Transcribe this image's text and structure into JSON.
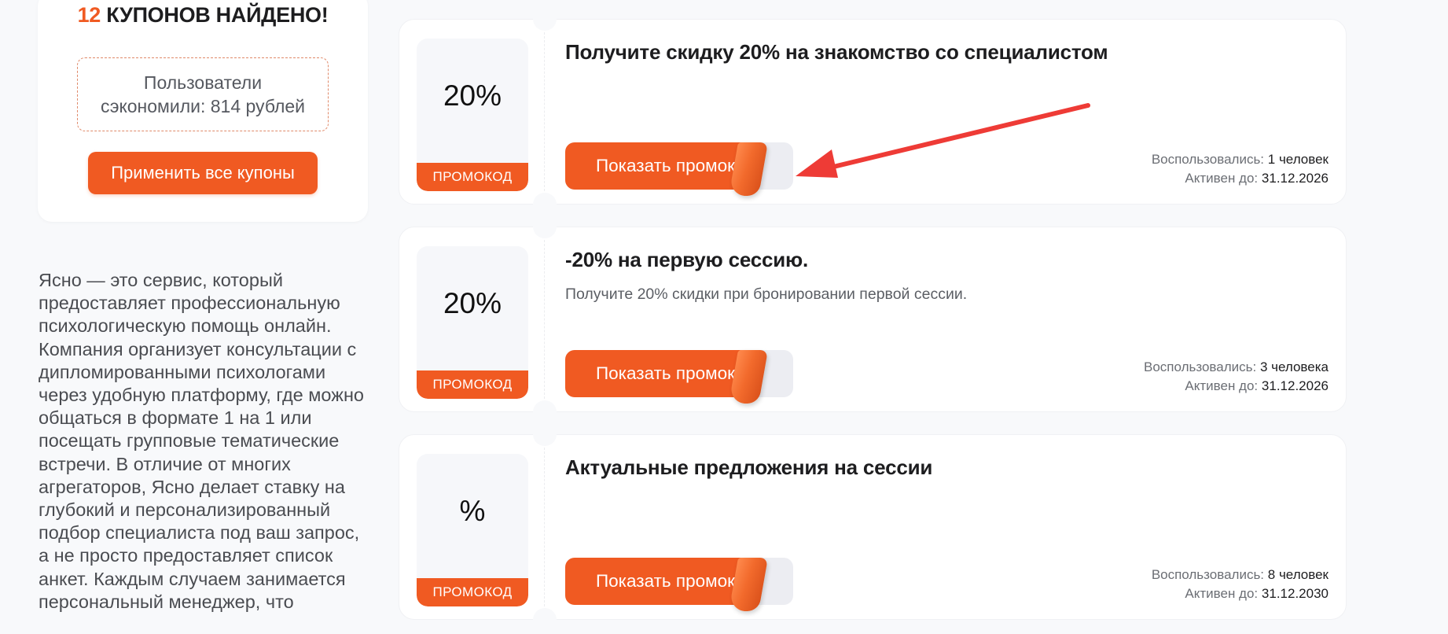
{
  "summary": {
    "count": "12",
    "found_label": "КУПОНОВ НАЙДЕНО!",
    "savings_line1": "Пользователи",
    "savings_line2": "сэкономили: 814 рублей",
    "apply_all_label": "Применить все купоны"
  },
  "about": {
    "text": "Ясно — это сервис, который предоставляет профессиональную психологическую помощь онлайн. Компания организует консультации с дипломированными психологами через удобную платформу, где можно общаться в формате 1 на 1 или посещать групповые тематические встречи. В отличие от многих агрегаторов, Ясно делает ставку на глубокий и персонализированный подбор специалиста под ваш запрос, а не просто предоставляет список анкет. Каждым случаем занимается персональный менеджер, что"
  },
  "coupons": [
    {
      "discount": "20%",
      "tag": "ПРОМОКОД",
      "title": "Получите скидку 20% на знакомство со специалистом",
      "description": "",
      "button_label": "Показать промокод",
      "used_label": "Воспользовались:",
      "used_value": "1 человек",
      "active_label": "Активен до:",
      "active_value": "31.12.2026"
    },
    {
      "discount": "20%",
      "tag": "ПРОМОКОД",
      "title": "-20% на первую сессию.",
      "description": "Получите 20% скидки при бронировании первой сессии.",
      "button_label": "Показать промокод",
      "used_label": "Воспользовались:",
      "used_value": "3 человека",
      "active_label": "Активен до:",
      "active_value": "31.12.2026"
    },
    {
      "discount": "%",
      "tag": "ПРОМОКОД",
      "title": "Актуальные предложения на сессии",
      "description": "",
      "button_label": "Показать промокод",
      "used_label": "Воспользовались:",
      "used_value": "8 человек",
      "active_label": "Активен до:",
      "active_value": "31.12.2030"
    }
  ],
  "colors": {
    "accent": "#f05a22",
    "arrow": "#ee3b36",
    "background": "#f8f9fb"
  }
}
